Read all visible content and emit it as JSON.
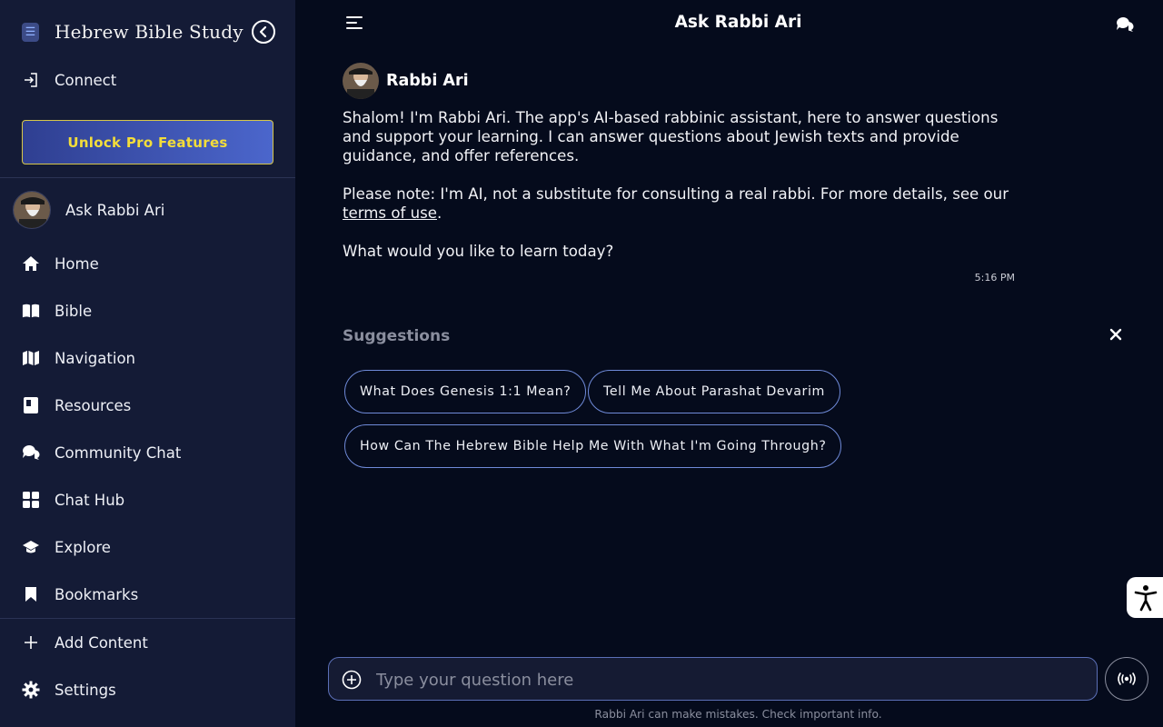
{
  "sidebar": {
    "brand_title": "Hebrew Bible Study",
    "connect_label": "Connect",
    "pro_button_label": "Unlock Pro Features",
    "profile_label": "Ask Rabbi Ari",
    "items": [
      {
        "label": "Home",
        "icon": "home-icon"
      },
      {
        "label": "Bible",
        "icon": "book-open-icon"
      },
      {
        "label": "Navigation",
        "icon": "map-icon"
      },
      {
        "label": "Resources",
        "icon": "resources-icon"
      },
      {
        "label": "Community Chat",
        "icon": "chat-bubbles-icon"
      },
      {
        "label": "Chat Hub",
        "icon": "grid-icon"
      },
      {
        "label": "Explore",
        "icon": "graduation-cap-icon"
      },
      {
        "label": "Bookmarks",
        "icon": "bookmark-icon"
      }
    ],
    "add_content_label": "Add Content",
    "settings_label": "Settings"
  },
  "header": {
    "title": "Ask Rabbi Ari"
  },
  "message": {
    "author": "Rabbi Ari",
    "paragraph1": "Shalom! I'm Rabbi Ari. The app's AI-based rabbinic assistant, here to answer questions and support your learning. I can answer questions about Jewish texts and provide guidance, and offer references.",
    "paragraph2_before": "Please note: I'm AI, not a substitute for consulting a real rabbi. For more details, see our ",
    "paragraph2_link": "terms of use",
    "paragraph2_after": ".",
    "paragraph3": "What would you like to learn today?",
    "time": "5:16 PM"
  },
  "suggestions": {
    "title": "Suggestions",
    "items": [
      "What Does Genesis 1:1 Mean?",
      "Tell Me About Parashat Devarim",
      "How Can The Hebrew Bible Help Me With What I'm Going Through?"
    ]
  },
  "input": {
    "placeholder": "Type your question here"
  },
  "footer": {
    "disclaimer": "Rabbi Ari can make mistakes. Check important info."
  },
  "colors": {
    "background": "#050b1c",
    "sidebar": "#141b36",
    "pro_text": "#f3dd3a",
    "chip_border": "#6f8ad8"
  }
}
